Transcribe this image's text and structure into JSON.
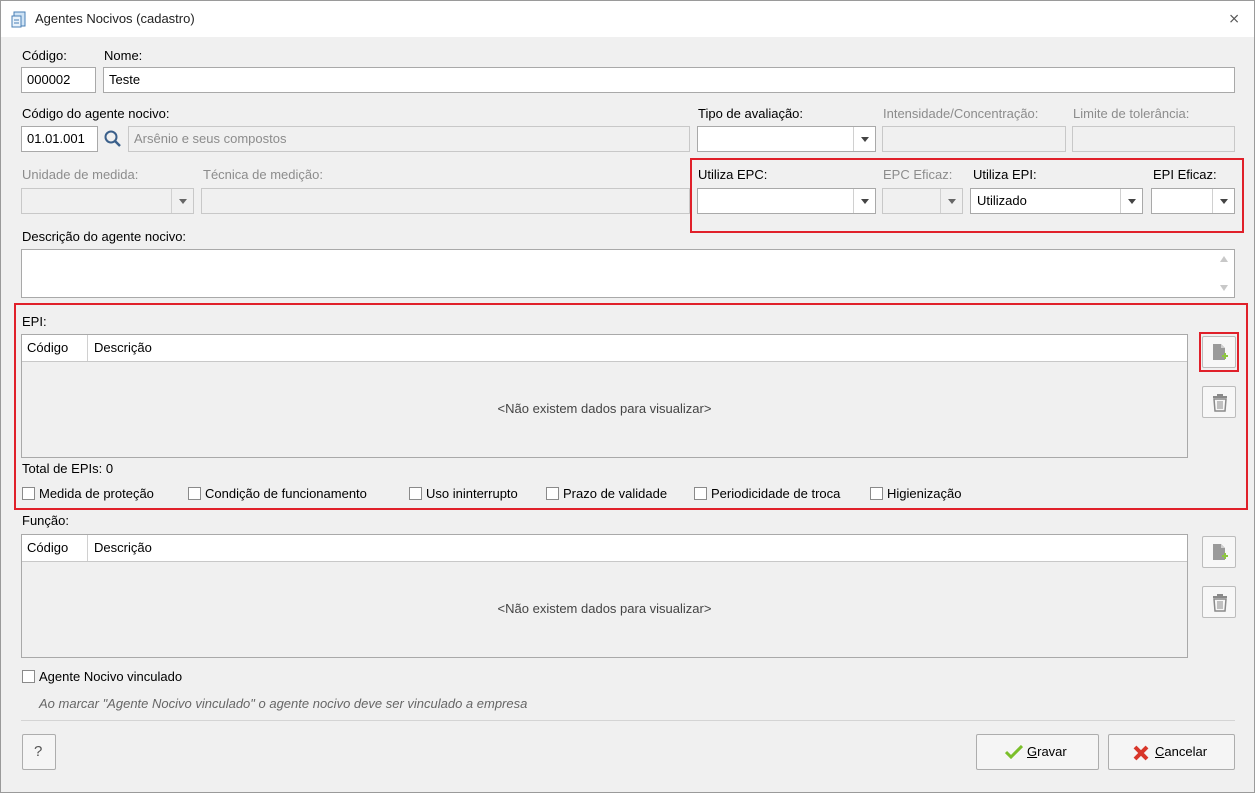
{
  "window": {
    "title": "Agentes Nocivos (cadastro)",
    "icon": "form-icon",
    "close_icon": "close-icon"
  },
  "form": {
    "codigo_label": "Código:",
    "codigo_value": "000002",
    "nome_label": "Nome:",
    "nome_value": "Teste",
    "agente_label": "Código do agente nocivo:",
    "agente_code": "01.01.001",
    "agente_desc": "Arsênio e seus compostos",
    "tipo_label": "Tipo de avaliação:",
    "tipo_value": "",
    "intensidade_label": "Intensidade/Concentração:",
    "limite_label": "Limite de tolerância:",
    "unidade_label": "Unidade de medida:",
    "tecnica_label": "Técnica de medição:",
    "utiliza_epc_label": "Utiliza EPC:",
    "utiliza_epc_value": "",
    "epc_eficaz_label": "EPC Eficaz:",
    "utiliza_epi_label": "Utiliza EPI:",
    "utiliza_epi_value": "Utilizado",
    "epi_eficaz_label": "EPI Eficaz:",
    "descricao_label": "Descrição do agente nocivo:",
    "descricao_value": ""
  },
  "epi": {
    "label": "EPI:",
    "columns": [
      "Código",
      "Descrição"
    ],
    "empty_text": "<Não existem dados para visualizar>",
    "total_text": "Total de EPIs: 0",
    "checkboxes": [
      "Medida de proteção",
      "Condição de funcionamento",
      "Uso ininterrupto",
      "Prazo de validade",
      "Periodicidade de troca",
      "Higienização"
    ]
  },
  "funcao": {
    "label": "Função:",
    "columns": [
      "Código",
      "Descrição"
    ],
    "empty_text": "<Não existem dados para visualizar>"
  },
  "vinculado": {
    "label": "Agente Nocivo vinculado",
    "hint": "Ao marcar \"Agente Nocivo vinculado\" o agente nocivo deve ser vinculado a empresa"
  },
  "buttons": {
    "help": "?",
    "gravar_first": "G",
    "gravar_rest": "ravar",
    "cancelar_first": "C",
    "cancelar_rest": "ancelar"
  },
  "colors": {
    "highlight": "#e0202a",
    "accent_green": "#8dc63f"
  }
}
